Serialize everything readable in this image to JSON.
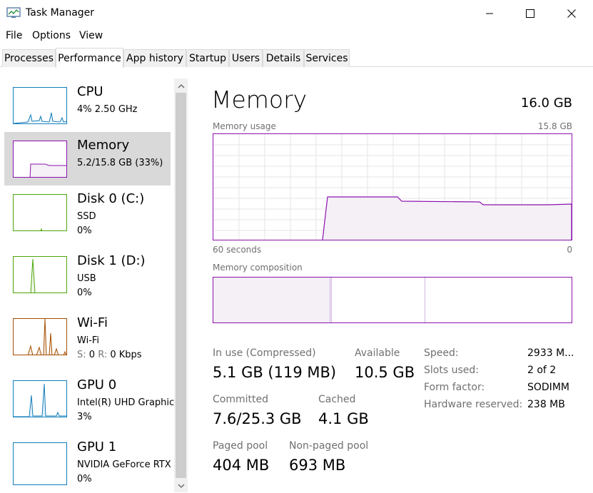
{
  "window": {
    "title": "Task Manager",
    "icon": "task-manager-icon"
  },
  "menu": [
    "File",
    "Options",
    "View"
  ],
  "tabs": [
    {
      "label": "Processes",
      "active": false
    },
    {
      "label": "Performance",
      "active": true
    },
    {
      "label": "App history",
      "active": false
    },
    {
      "label": "Startup",
      "active": false
    },
    {
      "label": "Users",
      "active": false
    },
    {
      "label": "Details",
      "active": false
    },
    {
      "label": "Services",
      "active": false
    }
  ],
  "sidebar": [
    {
      "title": "CPU",
      "line1": "4%  2.50 GHz",
      "color": "#117dbb"
    },
    {
      "title": "Memory",
      "line1": "5.2/15.8 GB (33%)",
      "color": "#8b12ae",
      "selected": true
    },
    {
      "title": "Disk 0 (C:)",
      "line1": "SSD",
      "line2": "0%",
      "color": "#4da60c"
    },
    {
      "title": "Disk 1 (D:)",
      "line1": "USB",
      "line2": "0%",
      "color": "#4da60c"
    },
    {
      "title": "Wi-Fi",
      "line1": "Wi-Fi",
      "line2_s": "S:",
      "line2_sv": "0",
      "line2_r": "R:",
      "line2_rv": "0 Kbps",
      "color": "#a74f01"
    },
    {
      "title": "GPU 0",
      "line1": "Intel(R) UHD Graphics",
      "line2": "3%",
      "color": "#117dbb"
    },
    {
      "title": "GPU 1",
      "line1": "NVIDIA GeForce RTX",
      "line2": "0%",
      "color": "#117dbb"
    }
  ],
  "main": {
    "title": "Memory",
    "total": "16.0 GB",
    "usage_label": "Memory usage",
    "usage_max": "15.8 GB",
    "time_left": "60 seconds",
    "time_right": "0",
    "composition_label": "Memory composition",
    "accent": "#8b12ae"
  },
  "stats": {
    "in_use_label": "In use (Compressed)",
    "in_use_value": "5.1 GB (119 MB)",
    "available_label": "Available",
    "available_value": "10.5 GB",
    "committed_label": "Committed",
    "committed_value": "7.6/25.3 GB",
    "cached_label": "Cached",
    "cached_value": "4.1 GB",
    "paged_label": "Paged pool",
    "paged_value": "404 MB",
    "nonpaged_label": "Non-paged pool",
    "nonpaged_value": "693 MB"
  },
  "details": [
    {
      "label": "Speed:",
      "value": "2933 M..."
    },
    {
      "label": "Slots used:",
      "value": "2 of 2"
    },
    {
      "label": "Form factor:",
      "value": "SODIMM"
    },
    {
      "label": "Hardware reserved:",
      "value": "238 MB"
    }
  ]
}
